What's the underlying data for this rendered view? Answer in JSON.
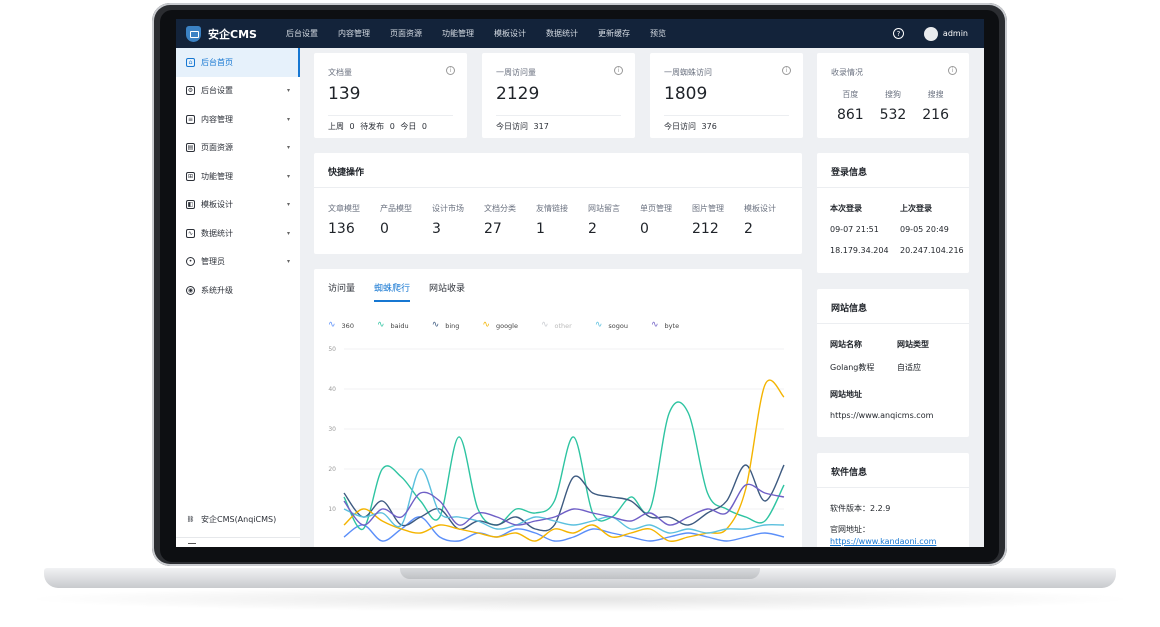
{
  "app": {
    "brand": "安企CMS"
  },
  "topnav": [
    "后台设置",
    "内容管理",
    "页面资源",
    "功能管理",
    "模板设计",
    "数据统计",
    "更新缓存",
    "预览"
  ],
  "user": {
    "name": "admin"
  },
  "sidebar": {
    "items": [
      {
        "label": "后台首页",
        "icon": "home-icon",
        "active": true,
        "chevron": false
      },
      {
        "label": "后台设置",
        "icon": "settings-icon",
        "active": false,
        "chevron": true
      },
      {
        "label": "内容管理",
        "icon": "content-icon",
        "active": false,
        "chevron": true
      },
      {
        "label": "页面资源",
        "icon": "page-icon",
        "active": false,
        "chevron": true
      },
      {
        "label": "功能管理",
        "icon": "grid-icon",
        "active": false,
        "chevron": true
      },
      {
        "label": "模板设计",
        "icon": "template-icon",
        "active": false,
        "chevron": true
      },
      {
        "label": "数据统计",
        "icon": "chart-icon",
        "active": false,
        "chevron": true
      },
      {
        "label": "管理员",
        "icon": "user-icon",
        "active": false,
        "chevron": true
      },
      {
        "label": "系统升级",
        "icon": "eye-icon",
        "active": false,
        "chevron": false
      }
    ],
    "footer": "安企CMS(AnqiCMS)"
  },
  "stats": {
    "docs": {
      "label": "文档量",
      "value": "139",
      "foot": [
        "上周",
        "0",
        "待发布",
        "0",
        "今日",
        "0"
      ]
    },
    "week_visits": {
      "label": "一周访问量",
      "value": "2129",
      "foot_label": "今日访问",
      "foot_value": "317"
    },
    "week_spider": {
      "label": "一周蜘蛛访问",
      "value": "1809",
      "foot_label": "今日访问",
      "foot_value": "376"
    },
    "index": {
      "label": "收录情况",
      "cols": [
        {
          "name": "百度",
          "value": "861"
        },
        {
          "name": "搜狗",
          "value": "532"
        },
        {
          "name": "搜搜",
          "value": "216"
        }
      ]
    }
  },
  "quick": {
    "title": "快捷操作",
    "items": [
      {
        "name": "文章模型",
        "value": "136"
      },
      {
        "name": "产品模型",
        "value": "0"
      },
      {
        "name": "设计市场",
        "value": "3"
      },
      {
        "name": "文档分类",
        "value": "27"
      },
      {
        "name": "友情链接",
        "value": "1"
      },
      {
        "name": "网站留言",
        "value": "2"
      },
      {
        "name": "单页管理",
        "value": "0"
      },
      {
        "name": "图片管理",
        "value": "212"
      },
      {
        "name": "模板设计",
        "value": "2"
      }
    ]
  },
  "login": {
    "title": "登录信息",
    "this_label": "本次登录",
    "last_label": "上次登录",
    "this_time": "09-07 21:51",
    "last_time": "09-05 20:49",
    "this_ip": "18.179.34.204",
    "last_ip": "20.247.104.216"
  },
  "site": {
    "title": "网站信息",
    "name_label": "网站名称",
    "type_label": "网站类型",
    "name_value": "Golang教程",
    "type_value": "自适应",
    "url_label": "网站地址",
    "url_value": "https://www.anqicms.com"
  },
  "software": {
    "title": "软件信息",
    "version": "软件版本：2.2.9",
    "site_label": "官网地址：",
    "site_url": "https://www.kandaoni.com"
  },
  "chart_tabs": [
    "访问量",
    "蜘蛛爬行",
    "网站收录"
  ],
  "active_chart_tab": 1,
  "colors": {
    "accent": "#1677d2",
    "topbar": "#13233a"
  },
  "chart_data": {
    "type": "line",
    "ylim": [
      0,
      50
    ],
    "yticks": [
      "50",
      "40",
      "30",
      "20",
      "10"
    ],
    "series": [
      {
        "name": "360",
        "color": "#5b8ff9",
        "values": [
          3,
          6,
          2,
          5,
          8,
          3,
          2,
          4,
          3,
          5,
          4,
          2,
          3,
          5,
          4,
          3,
          2,
          3,
          4,
          3,
          2,
          3,
          4,
          3
        ]
      },
      {
        "name": "baidu",
        "color": "#2ec4a1",
        "values": [
          13,
          5,
          20,
          18,
          12,
          8,
          28,
          10,
          6,
          10,
          9,
          12,
          28,
          9,
          8,
          13,
          10,
          34,
          34,
          14,
          10,
          8,
          7,
          16
        ]
      },
      {
        "name": "bing",
        "color": "#3d5a80",
        "values": [
          14,
          8,
          12,
          6,
          8,
          10,
          5,
          7,
          6,
          8,
          5,
          6,
          18,
          14,
          13,
          12,
          8,
          8,
          6,
          9,
          12,
          21,
          12,
          21
        ]
      },
      {
        "name": "google",
        "color": "#f4b400",
        "values": [
          6,
          10,
          7,
          5,
          4,
          6,
          5,
          4,
          3,
          4,
          2,
          5,
          4,
          6,
          3,
          4,
          5,
          2,
          3,
          4,
          5,
          15,
          41,
          38
        ]
      },
      {
        "name": "other",
        "color": "#c9ccd1",
        "values": [
          0,
          0,
          0,
          0,
          0,
          0,
          0,
          0,
          0,
          0,
          0,
          0,
          0,
          0,
          0,
          0,
          0,
          0,
          0,
          0,
          0,
          0,
          0,
          0
        ]
      },
      {
        "name": "sogou",
        "color": "#5bc0de",
        "values": [
          10,
          8,
          9,
          6,
          20,
          9,
          8,
          7,
          5,
          6,
          8,
          7,
          6,
          7,
          8,
          5,
          6,
          4,
          5,
          4,
          5,
          5,
          6,
          6
        ]
      },
      {
        "name": "byte",
        "color": "#6f5fc6",
        "values": [
          12,
          6,
          10,
          8,
          14,
          12,
          6,
          9,
          8,
          6,
          7,
          8,
          10,
          9,
          8,
          7,
          9,
          6,
          8,
          10,
          9,
          16,
          14,
          13
        ]
      }
    ]
  }
}
